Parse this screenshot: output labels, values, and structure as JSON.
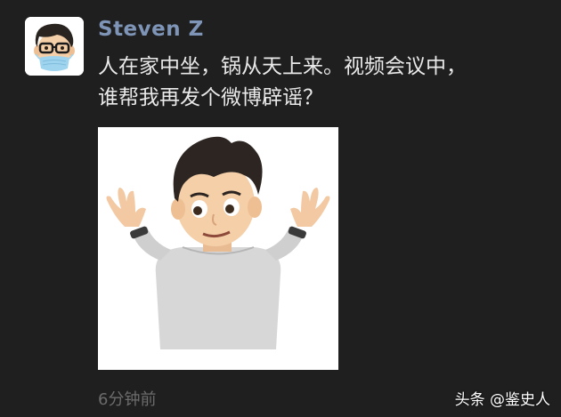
{
  "post": {
    "author": "Steven Z",
    "text_lines": [
      "人在家中坐，锅从天上来。视频会议中，",
      "谁帮我再发个微博辟谣？"
    ],
    "time": "6分钟前",
    "avatar_icon": "memoji-with-glasses-and-mask-avatar",
    "image_icon": "shrugging-memoji-image"
  },
  "watermark": "头条 @鉴史人",
  "colors": {
    "background": "#1f1f1f",
    "author_name": "#7e95b7",
    "text": "#e9e9e9",
    "time": "#6c6c6c"
  }
}
